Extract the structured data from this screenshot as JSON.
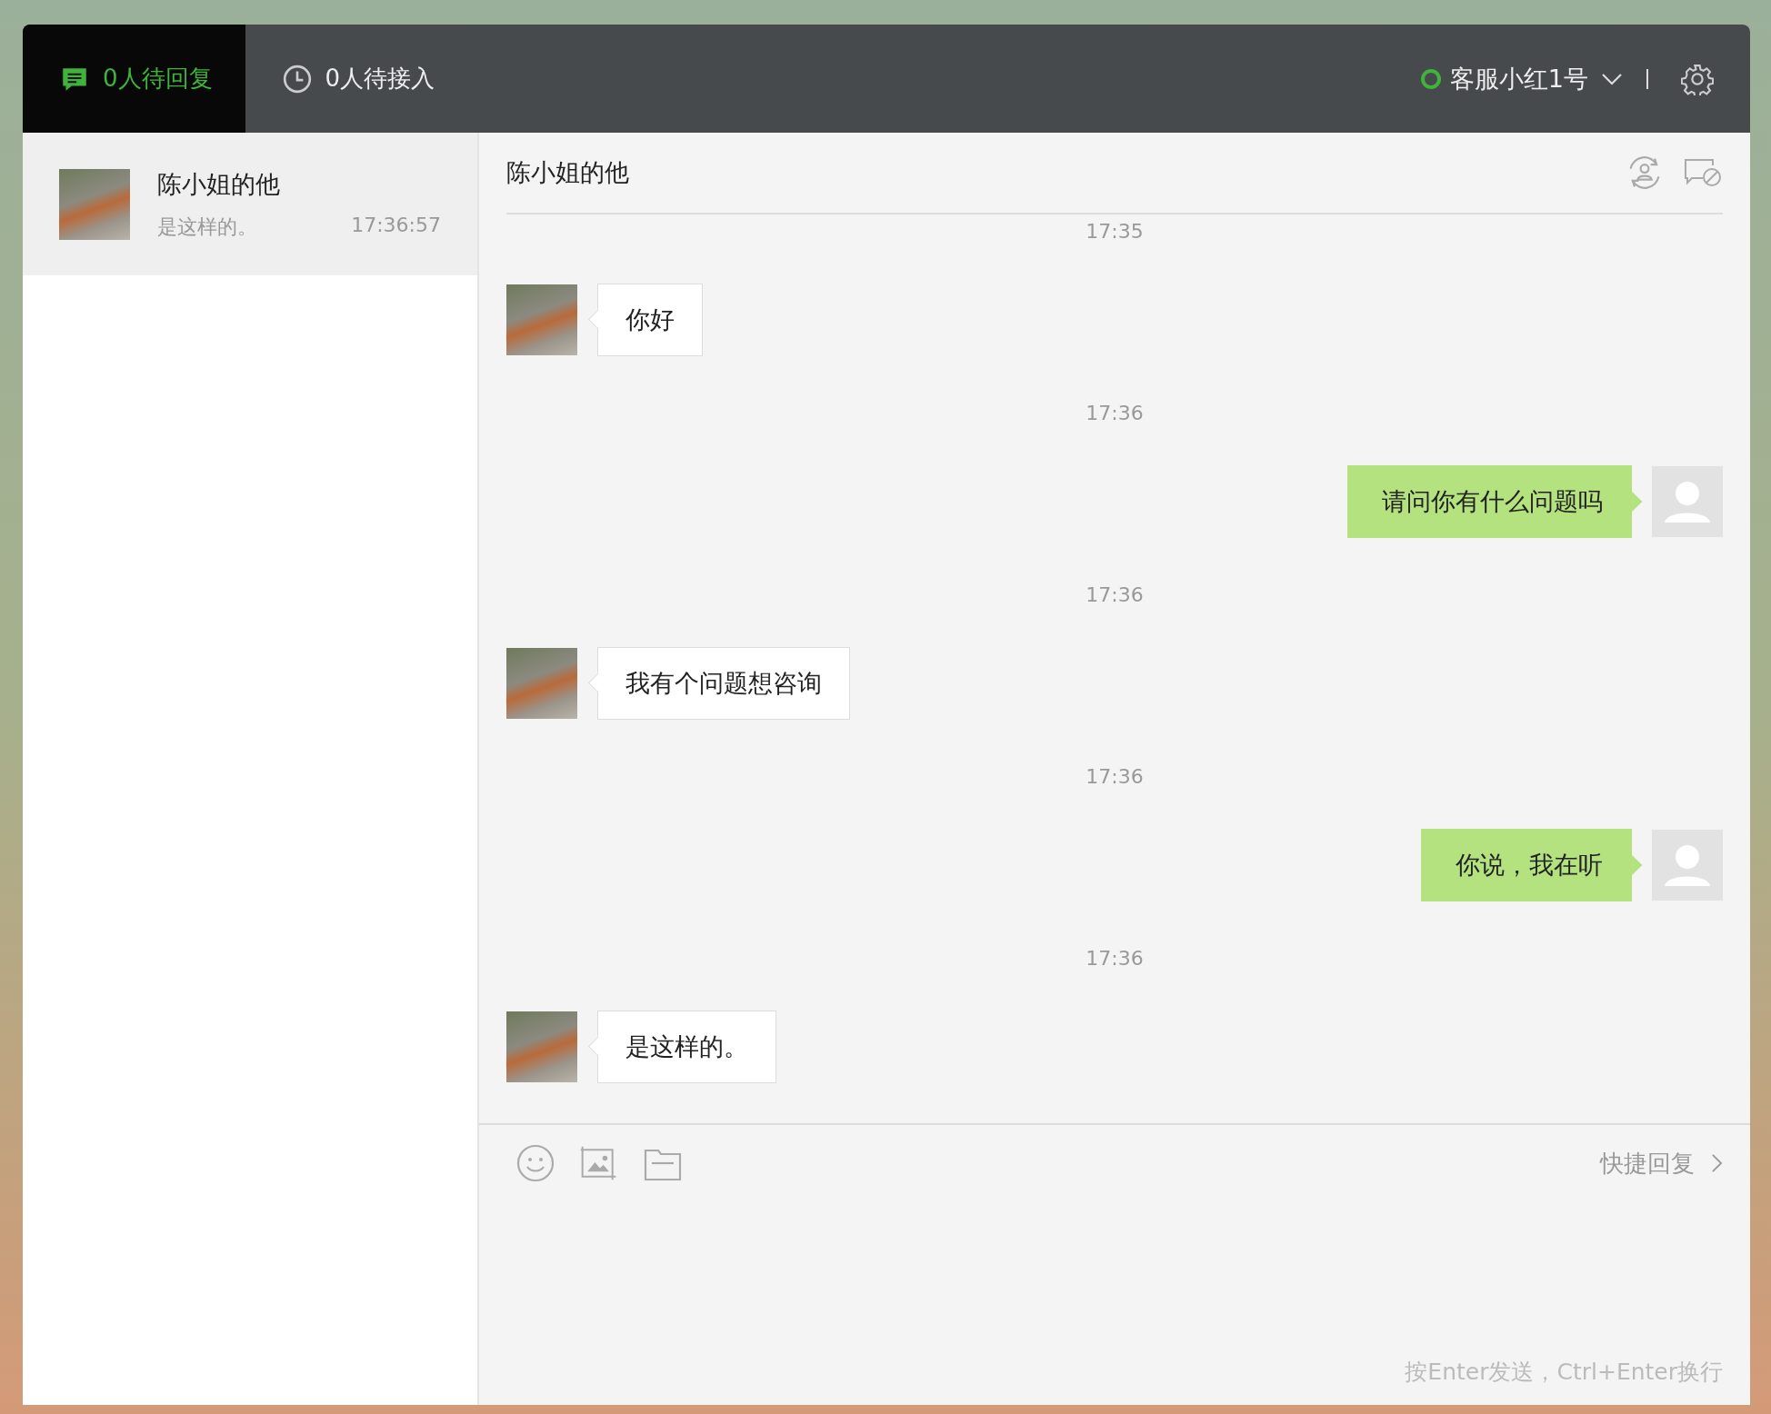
{
  "tabs": [
    {
      "label": "0人待回复",
      "selected": true,
      "kind": "chat"
    },
    {
      "label": "0人待接入",
      "selected": false,
      "kind": "clock"
    }
  ],
  "agent": {
    "name": "客服小红1号",
    "online": true
  },
  "conversations": [
    {
      "name": "陈小姐的他",
      "preview": "是这样的。",
      "time": "17:36:57",
      "selected": true
    }
  ],
  "chat": {
    "title": "陈小姐的他",
    "messages": [
      {
        "time": "17:35",
        "kind": "in",
        "text": "你好"
      },
      {
        "time": "17:36",
        "kind": "out",
        "text": "请问你有什么问题吗"
      },
      {
        "time": "17:36",
        "kind": "in",
        "text": "我有个问题想咨询"
      },
      {
        "time": "17:36",
        "kind": "out",
        "text": "你说，我在听"
      },
      {
        "time": "17:36",
        "kind": "in",
        "text": "是这样的。"
      }
    ]
  },
  "composer": {
    "quick_reply": "快捷回复",
    "hint": "按Enter发送，Ctrl+Enter换行"
  }
}
